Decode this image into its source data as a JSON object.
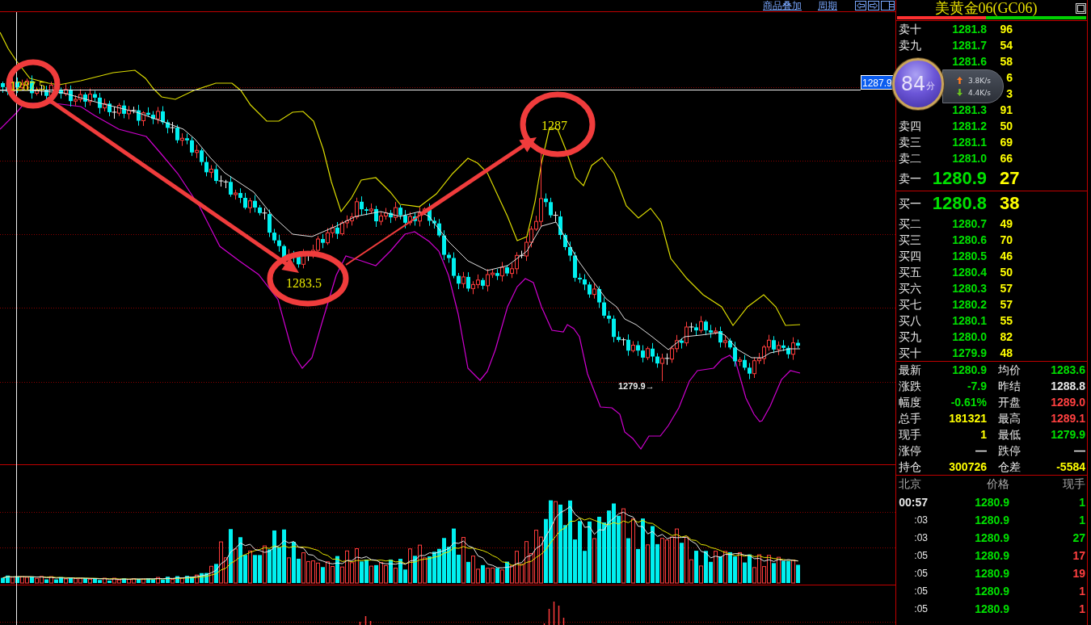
{
  "toolbar": {
    "links": [
      "商品叠加",
      "周期"
    ]
  },
  "chart": {
    "circled_prices": [
      "1287.5",
      "1283.5",
      "1287"
    ],
    "low_label": "1279.9→",
    "cursor_price": "1287.9"
  },
  "quote_panel": {
    "title": "美黄金06(GC06)",
    "ratio_bar": {
      "level": 0.47
    },
    "asks": [
      {
        "kind": "level",
        "label": "卖十",
        "price": "1281.8",
        "volume": "96"
      },
      {
        "kind": "level",
        "label": "卖九",
        "price": "1281.7",
        "volume": "54"
      },
      {
        "kind": "level",
        "price": "1281.6",
        "volume": "58"
      },
      {
        "kind": "level",
        "volume": "6"
      },
      {
        "kind": "level",
        "volume": "3"
      },
      {
        "kind": "level",
        "price": "1281.3",
        "volume": "91"
      },
      {
        "kind": "level",
        "label": "卖四",
        "price": "1281.2",
        "volume": "50"
      },
      {
        "kind": "level",
        "label": "卖三",
        "price": "1281.1",
        "volume": "69"
      },
      {
        "kind": "level",
        "label": "卖二",
        "price": "1281.0",
        "volume": "66"
      },
      {
        "kind": "best",
        "label": "卖一",
        "price": "1280.9",
        "volume": "27"
      }
    ],
    "bids": [
      {
        "kind": "best",
        "label": "买一",
        "price": "1280.8",
        "volume": "38"
      },
      {
        "kind": "level",
        "label": "买二",
        "price": "1280.7",
        "volume": "49"
      },
      {
        "kind": "level",
        "label": "买三",
        "price": "1280.6",
        "volume": "70"
      },
      {
        "kind": "level",
        "label": "买四",
        "price": "1280.5",
        "volume": "46"
      },
      {
        "kind": "level",
        "label": "买五",
        "price": "1280.4",
        "volume": "50"
      },
      {
        "kind": "level",
        "label": "买六",
        "price": "1280.3",
        "volume": "57"
      },
      {
        "kind": "level",
        "label": "买七",
        "price": "1280.2",
        "volume": "57"
      },
      {
        "kind": "level",
        "label": "买八",
        "price": "1280.1",
        "volume": "55"
      },
      {
        "kind": "level",
        "label": "买九",
        "price": "1280.0",
        "volume": "82"
      },
      {
        "kind": "level",
        "label": "买十",
        "price": "1279.9",
        "volume": "48"
      }
    ],
    "stats": [
      {
        "label": "最新",
        "value": "1280.9",
        "color": "#00e000"
      },
      {
        "label": "均价",
        "value": "1283.6",
        "color": "#00e000"
      },
      {
        "label": "涨跌",
        "value": "-7.9",
        "color": "#00e000"
      },
      {
        "label": "昨结",
        "value": "1288.8",
        "color": "#e6e6e6"
      },
      {
        "label": "幅度",
        "value": "-0.61%",
        "color": "#00e000"
      },
      {
        "label": "开盘",
        "value": "1289.0",
        "color": "#ff4040"
      },
      {
        "label": "总手",
        "value": "181321",
        "color": "#ffff00"
      },
      {
        "label": "最高",
        "value": "1289.1",
        "color": "#ff4040"
      },
      {
        "label": "现手",
        "value": "1",
        "color": "#ffff00"
      },
      {
        "label": "最低",
        "value": "1279.9",
        "color": "#00e000"
      },
      {
        "label": "涨停",
        "value": "—",
        "color": "#e6e6e6"
      },
      {
        "label": "跌停",
        "value": "—",
        "color": "#e6e6e6"
      },
      {
        "label": "持仓",
        "value": "300726",
        "color": "#ffff00"
      },
      {
        "label": "仓差",
        "value": "-5584",
        "color": "#ffff00"
      }
    ],
    "ticks": {
      "columns": [
        "北京",
        "价格",
        "现手"
      ],
      "rows": [
        {
          "kind": "full",
          "time": "00:57",
          "price": "1280.9",
          "volume": "1",
          "color": "#00e000"
        },
        {
          "kind": "short",
          "time": ":03",
          "price": "1280.9",
          "volume": "1",
          "color": "#00e000"
        },
        {
          "kind": "short",
          "time": ":03",
          "price": "1280.9",
          "volume": "27",
          "color": "#00e000"
        },
        {
          "kind": "short",
          "time": ":05",
          "price": "1280.9",
          "volume": "17",
          "color": "#ff4040"
        },
        {
          "kind": "short",
          "time": ":05",
          "price": "1280.9",
          "volume": "19",
          "color": "#ff4040"
        },
        {
          "kind": "short",
          "time": ":05",
          "price": "1280.9",
          "volume": "1",
          "color": "#ff4040"
        },
        {
          "kind": "short",
          "time": ":05",
          "price": "1280.9",
          "volume": "1",
          "color": "#ff4040"
        }
      ]
    }
  },
  "speed_widget": {
    "score": "84",
    "unit": "分",
    "upload": "3.8K/s",
    "download": "4.4K/s"
  }
}
